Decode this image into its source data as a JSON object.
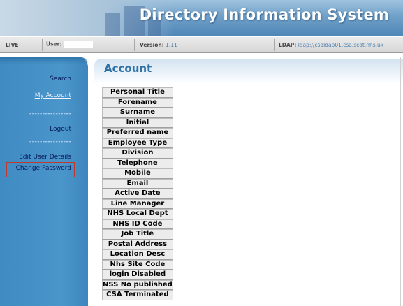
{
  "app": {
    "title": "Directory Information System"
  },
  "statusbar": {
    "env_label": "LIVE",
    "user_label": "User:",
    "user_value": "",
    "version_label": "Version:",
    "version_value": "1.11",
    "ldap_label": "LDAP:",
    "ldap_value": "ldap://csaldap01.csa.scot.nhs.uk"
  },
  "sidebar": {
    "items": [
      {
        "label": "Search"
      },
      {
        "label": "My Account"
      },
      {
        "label": "----------------"
      },
      {
        "label": "Logout"
      },
      {
        "label": "----------------"
      },
      {
        "label": "Edit User Details"
      },
      {
        "label": "Change Password"
      }
    ]
  },
  "main": {
    "title": "Account",
    "fields": [
      "Personal Title",
      "Forename",
      "Surname",
      "Initial",
      "Preferred name",
      "Employee Type",
      "Division",
      "Telephone",
      "Mobile",
      "Email",
      "Active Date",
      "Line Manager",
      "NHS Local Dept",
      "NHS ID Code",
      "Job Title",
      "Postal Address",
      "Location Desc",
      "Nhs Site Code",
      "login Disabled",
      "NSS No published",
      "CSA Terminated"
    ]
  },
  "colors": {
    "sidebar_bg": "#4a96cb",
    "title_blue": "#2f72a8",
    "link_dark": "#0a1a5a",
    "highlight": "#c0392b"
  }
}
